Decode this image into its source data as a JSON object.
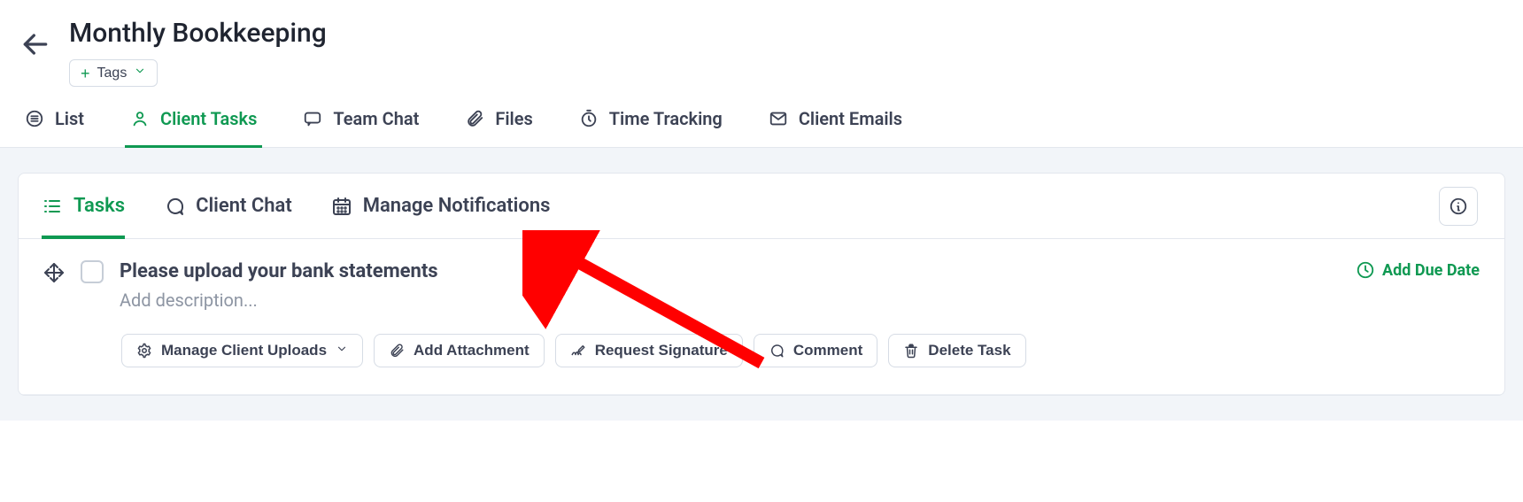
{
  "header": {
    "title": "Monthly Bookkeeping",
    "tags_label": "Tags"
  },
  "tabs_primary": [
    {
      "id": "list",
      "label": "List",
      "icon": "list-icon"
    },
    {
      "id": "client-tasks",
      "label": "Client Tasks",
      "icon": "user-icon"
    },
    {
      "id": "team-chat",
      "label": "Team Chat",
      "icon": "chat-icon"
    },
    {
      "id": "files",
      "label": "Files",
      "icon": "paperclip-icon"
    },
    {
      "id": "time-tracking",
      "label": "Time Tracking",
      "icon": "stopwatch-icon"
    },
    {
      "id": "client-emails",
      "label": "Client Emails",
      "icon": "mail-icon"
    }
  ],
  "active_primary_tab": "client-tasks",
  "subtabs": [
    {
      "id": "tasks",
      "label": "Tasks",
      "icon": "tasks-list-icon"
    },
    {
      "id": "client-chat",
      "label": "Client Chat",
      "icon": "chat-icon"
    },
    {
      "id": "manage-notifications",
      "label": "Manage Notifications",
      "icon": "calendar-icon"
    }
  ],
  "active_subtab": "tasks",
  "task": {
    "title": "Please upload your bank statements",
    "description_placeholder": "Add description...",
    "due_label": "Add Due Date"
  },
  "task_actions": {
    "manage_uploads": "Manage Client Uploads",
    "add_attachment": "Add Attachment",
    "request_signature": "Request Signature",
    "comment": "Comment",
    "delete_task": "Delete Task"
  },
  "colors": {
    "accent": "#0f9952",
    "text": "#3c4254",
    "muted": "#8d95a3",
    "arrow": "#ff0000"
  }
}
